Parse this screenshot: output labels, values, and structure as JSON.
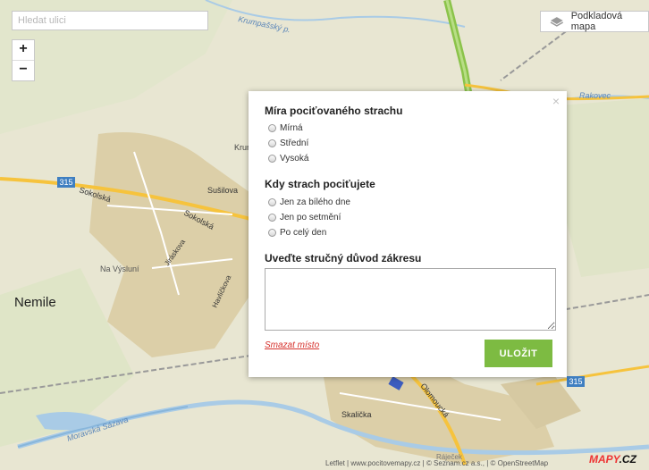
{
  "search": {
    "placeholder": "Hledat ulici"
  },
  "zoom": {
    "in": "+",
    "out": "−"
  },
  "layer_button": {
    "label": "Podkladová mapa",
    "icon": "layers-icon"
  },
  "map_labels": {
    "krumpassky": "Krumpašský p.",
    "rakovec": "Rakovec",
    "krum": "Krum",
    "sokolska1": "Sokolská",
    "sokolska2": "Sokolská",
    "susilova": "Sušilova",
    "jiraskova": "Jiráskova",
    "havlickova": "Havlíčkova",
    "na_vysluni": "Na Výsluní",
    "nemile": "Nemile",
    "skalicka": "Skalička",
    "olomoucka": "Olomoucká",
    "moravska_sazava": "Moravská Sázava",
    "rajecek": "Ráječek",
    "road_315_left": "315",
    "road_315_right": "315"
  },
  "dialog": {
    "close": "×",
    "fear_title": "Míra pociťovaného strachu",
    "fear_options": [
      "Mírná",
      "Střední",
      "Vysoká"
    ],
    "when_title": "Kdy strach pociťujete",
    "when_options": [
      "Jen za bílého dne",
      "Jen po setmění",
      "Po celý den"
    ],
    "reason_title": "Uveďte stručný důvod zákresu",
    "reason_value": "",
    "delete_link": "Smazat místo",
    "save_button": "ULOŽIT"
  },
  "attribution": {
    "text1": "Letflet | www.pocitovemapy.cz | © Seznam.cz a.s., | © OpenStreetMap",
    "logo_a": "MAPY",
    "logo_b": ".CZ"
  },
  "colors": {
    "accent": "#7dbb42",
    "delete": "#d6322d",
    "road_major": "#8bc34a",
    "road_yellow": "#f6c33d"
  }
}
